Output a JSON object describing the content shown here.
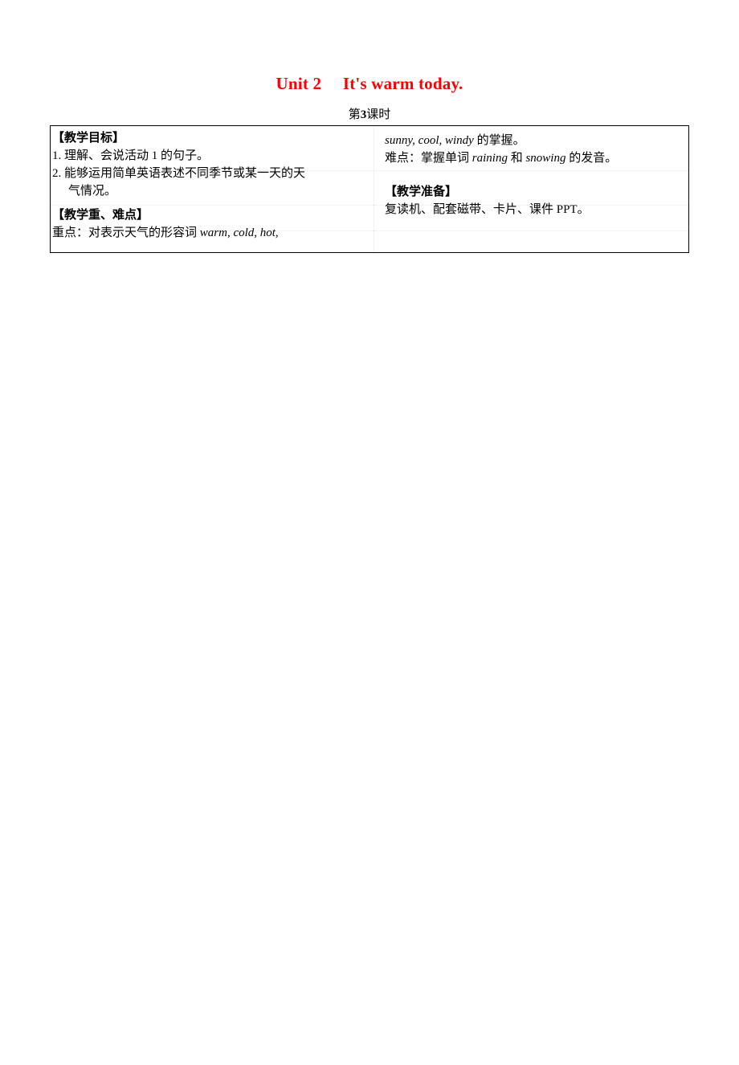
{
  "document": {
    "title_unit": "Unit 2",
    "title_sentence": "It's warm today.",
    "title_full": "Unit 2  It's warm today.",
    "title_color": "#FF0000",
    "subtitle_prefix": "第",
    "subtitle_number": "3",
    "subtitle_suffix": "课时"
  },
  "table": {
    "left_column": {
      "heading_objectives": "【教学目标】",
      "objective_1": "1. 理解、会说活动 1 的句子。",
      "objective_2": "2. 能够运用简单英语表述不同季节或某一天的天",
      "objective_2_cont": "气情况。",
      "heading_focus": "【教学重、难点】",
      "focus_label": "重点：对表示天气的形容词 ",
      "focus_words": "warm, cold, hot,"
    },
    "right_column": {
      "focus_words_cont": "sunny, cool, windy",
      "focus_tail": " 的掌握。",
      "difficulty_label": "难点：掌握单词 ",
      "difficulty_word_1": "raining",
      "difficulty_conj": " 和 ",
      "difficulty_word_2": "snowing",
      "difficulty_tail": " 的发音。",
      "heading_preparation": "【教学准备】",
      "preparation_items": "复读机、配套磁带、卡片、课件 PPT。"
    }
  }
}
